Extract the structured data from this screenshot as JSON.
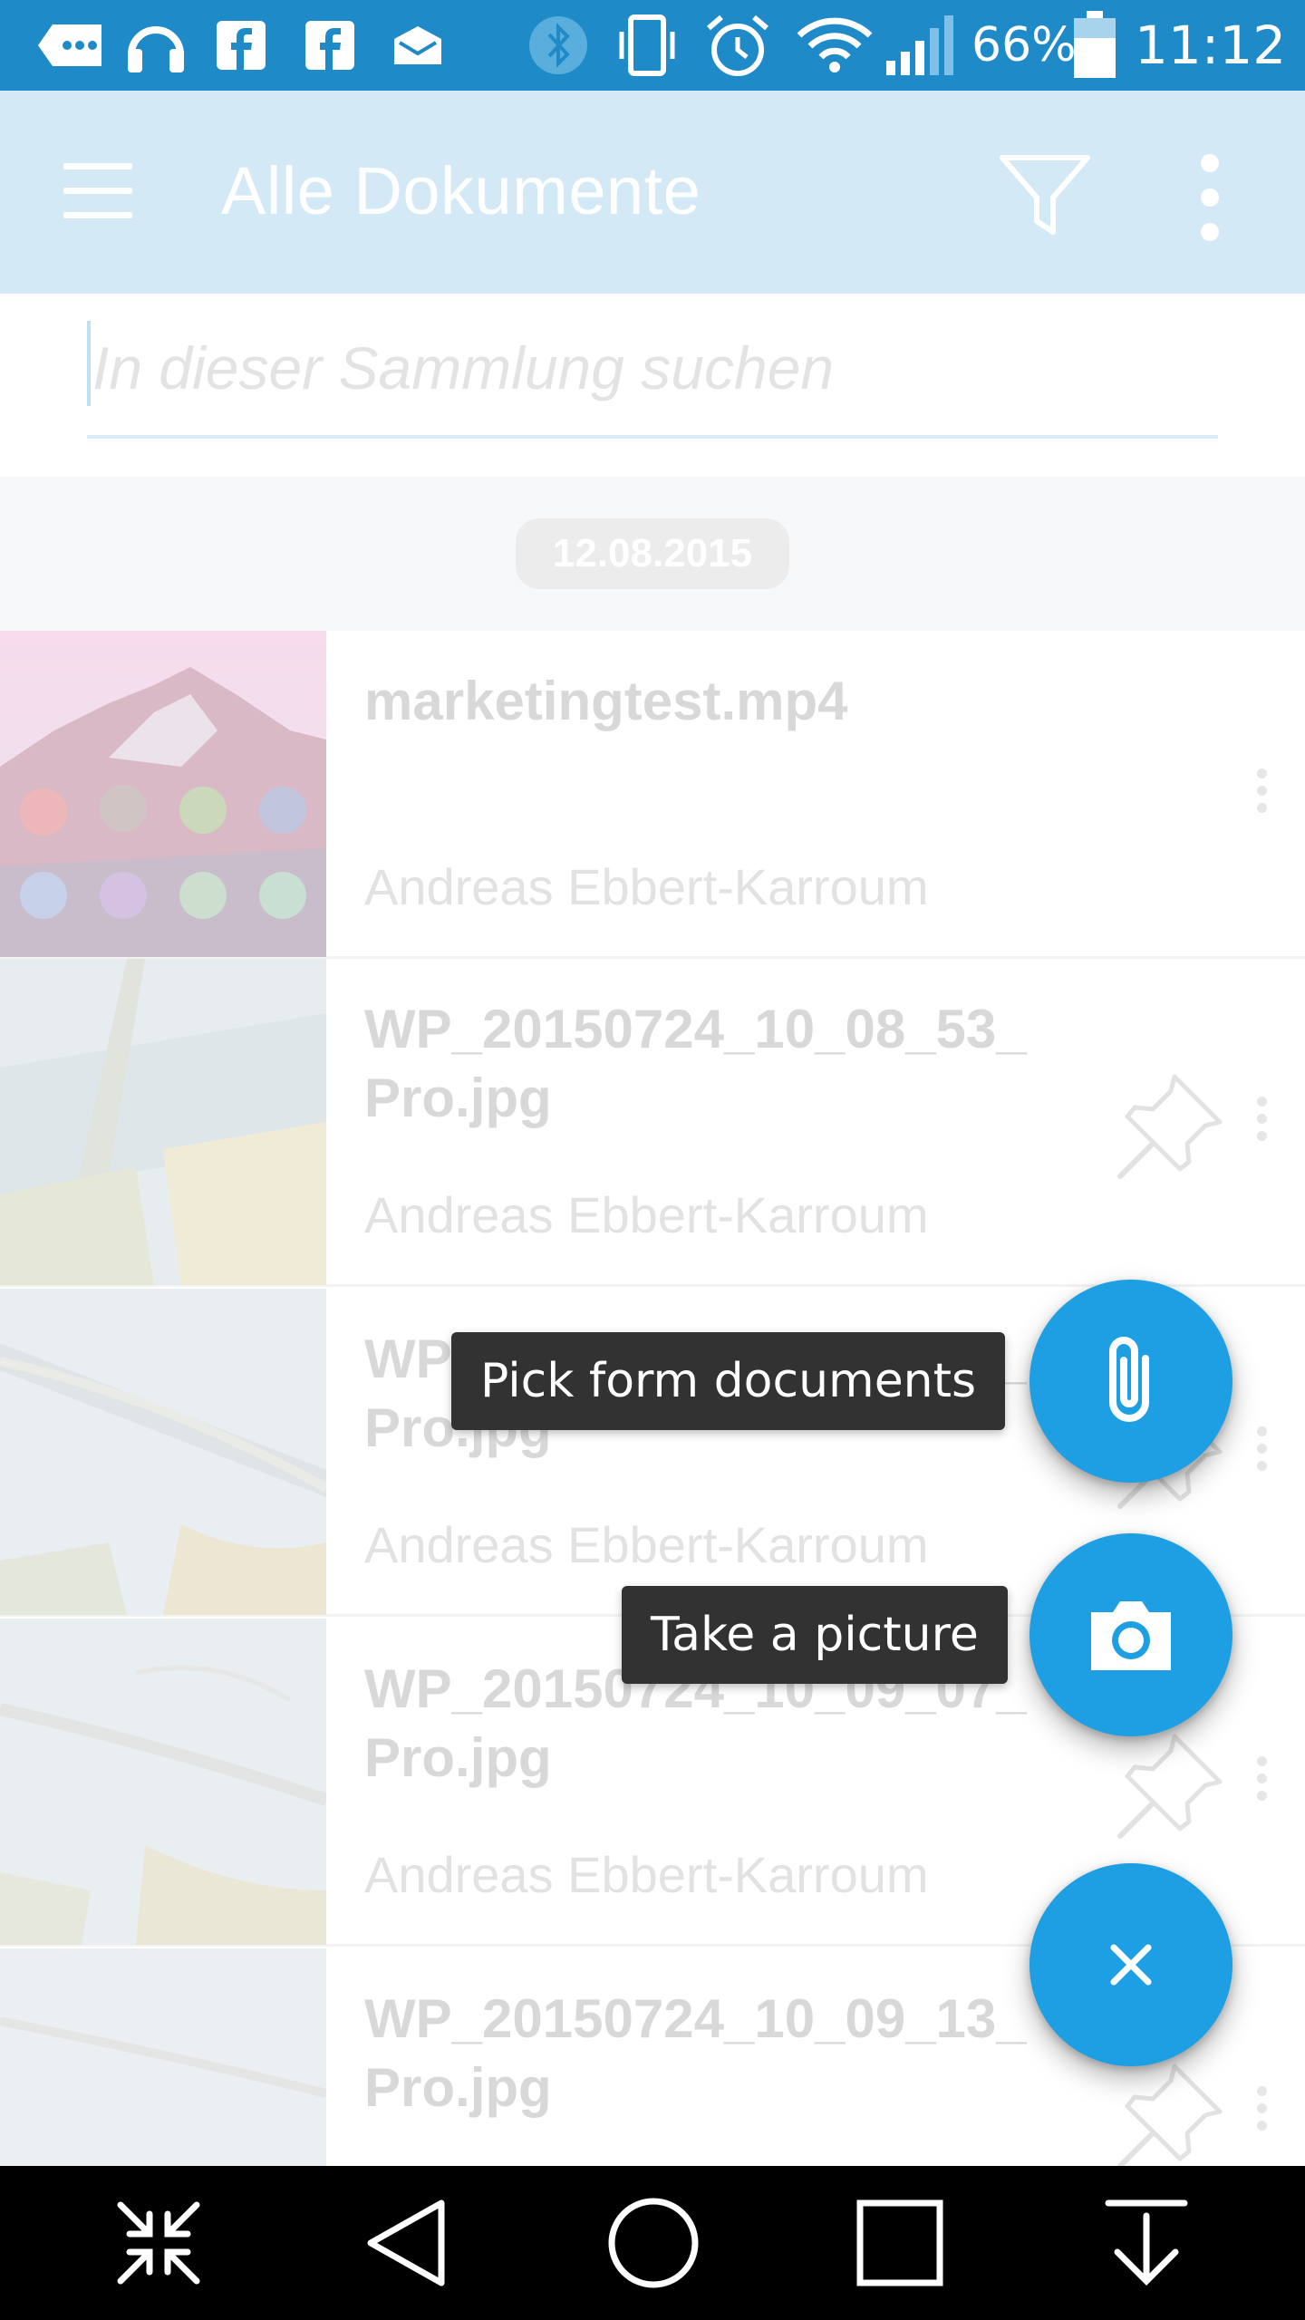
{
  "status_bar": {
    "battery_percent": "66%",
    "time": "11:12",
    "icons": [
      "messages-icon",
      "headset-icon",
      "facebook-icon",
      "facebook-icon",
      "mail-icon",
      "bluetooth-icon",
      "vibrate-icon",
      "alarm-icon",
      "wifi-icon",
      "signal-icon",
      "battery-icon"
    ]
  },
  "app_bar": {
    "title": "Alle Dokumente"
  },
  "search": {
    "placeholder": "In dieser Sammlung suchen"
  },
  "date_header": "12.08.2015",
  "documents": [
    {
      "name": "marketingtest.mp4",
      "author": "Andreas Ebbert-Karroum",
      "pinned": false
    },
    {
      "name": "WP_20150724_10_08_53_ Pro.jpg",
      "author": "Andreas Ebbert-Karroum",
      "pinned": true
    },
    {
      "name": "WP_20150724_10_09_03_ Pro.jpg",
      "author": "Andreas Ebbert-Karroum",
      "pinned": true
    },
    {
      "name": "WP_20150724_10_09_07_ Pro.jpg",
      "author": "Andreas Ebbert-Karroum",
      "pinned": true
    },
    {
      "name": "WP_20150724_10_09_13_ Pro.jpg",
      "author": "",
      "pinned": true
    }
  ],
  "fab_menu": {
    "pick_label": "Pick form documents",
    "picture_label": "Take a picture",
    "accent_color": "#1f9fe3"
  },
  "colors": {
    "status_bar": "#1f8ac8",
    "app_bar": "#d3eaf6"
  }
}
